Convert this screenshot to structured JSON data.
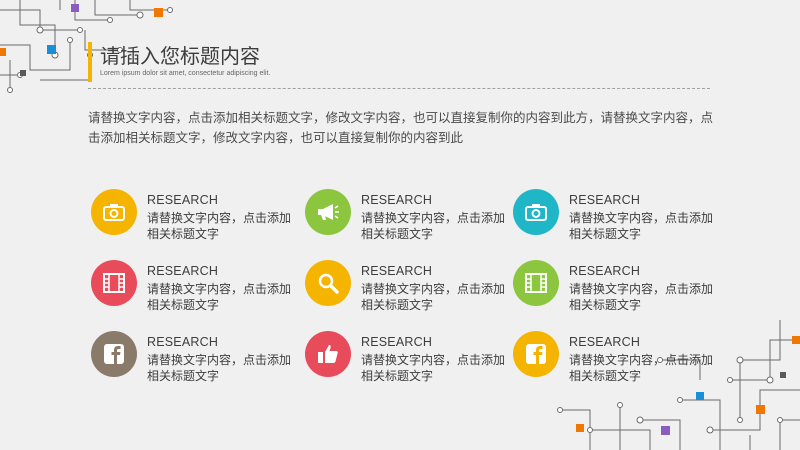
{
  "slide": {
    "title": "请插入您标题内容",
    "subtitle": "Lorem ipsum dolor sit amet, consectetur adipiscing elit.",
    "paragraph": "请替换文字内容，点击添加相关标题文字，修改文字内容，也可以直接复制你的内容到此方，请替换文字内容，点击添加相关标题文字，修改文字内容，也可以直接复制你的内容到此"
  },
  "cards": [
    {
      "label": "RESEARCH",
      "desc": "请替换文字内容，点击添加相关标题文字",
      "color": "#f4b400",
      "icon": "camera-icon"
    },
    {
      "label": "RESEARCH",
      "desc": "请替换文字内容，点击添加相关标题文字",
      "color": "#8cc63f",
      "icon": "megaphone-icon"
    },
    {
      "label": "RESEARCH",
      "desc": "请替换文字内容，点击添加相关标题文字",
      "color": "#1fb6c8",
      "icon": "camera-icon"
    },
    {
      "label": "RESEARCH",
      "desc": "请替换文字内容，点击添加相关标题文字",
      "color": "#e84b5a",
      "icon": "film-icon"
    },
    {
      "label": "RESEARCH",
      "desc": "请替换文字内容，点击添加相关标题文字",
      "color": "#f4b400",
      "icon": "search-icon"
    },
    {
      "label": "RESEARCH",
      "desc": "请替换文字内容，点击添加相关标题文字",
      "color": "#8cc63f",
      "icon": "film-icon"
    },
    {
      "label": "RESEARCH",
      "desc": "请替换文字内容，点击添加相关标题文字",
      "color": "#8a7a6a",
      "icon": "facebook-icon"
    },
    {
      "label": "RESEARCH",
      "desc": "请替换文字内容，点击添加相关标题文字",
      "color": "#e84b5a",
      "icon": "thumbs-up-icon"
    },
    {
      "label": "RESEARCH",
      "desc": "请替换文字内容，点击添加相关标题文字",
      "color": "#f4b400",
      "icon": "facebook-icon"
    }
  ],
  "colors": {
    "accent_bar": "#f4b400",
    "circuit_line": "#5a5a5a",
    "circuit_orange": "#f07800",
    "circuit_blue": "#1a8fd8",
    "circuit_purple": "#8a5cc0"
  }
}
